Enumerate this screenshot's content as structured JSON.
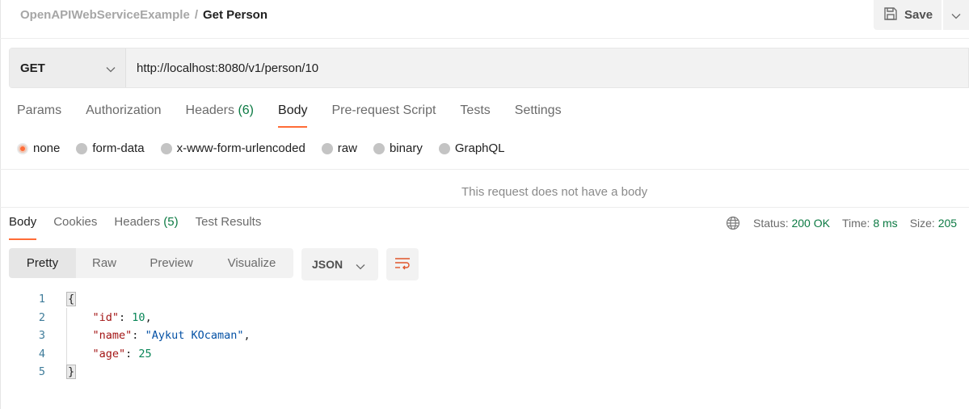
{
  "header": {
    "collection": "OpenAPIWebServiceExample",
    "separator": "/",
    "request_name": "Get Person",
    "save_label": "Save",
    "save_icon": "floppy-disk-icon",
    "more_icon": "chevron-down-icon"
  },
  "request": {
    "method": "GET",
    "url": "http://localhost:8080/v1/person/10",
    "tabs": [
      {
        "label": "Params",
        "count": null
      },
      {
        "label": "Authorization",
        "count": null
      },
      {
        "label": "Headers",
        "count": "(6)"
      },
      {
        "label": "Body",
        "count": null,
        "active": true
      },
      {
        "label": "Pre-request Script",
        "count": null
      },
      {
        "label": "Tests",
        "count": null
      },
      {
        "label": "Settings",
        "count": null
      }
    ],
    "body_types": [
      {
        "label": "none",
        "checked": true
      },
      {
        "label": "form-data",
        "checked": false
      },
      {
        "label": "x-www-form-urlencoded",
        "checked": false
      },
      {
        "label": "raw",
        "checked": false
      },
      {
        "label": "binary",
        "checked": false
      },
      {
        "label": "GraphQL",
        "checked": false
      }
    ],
    "empty_body_message": "This request does not have a body"
  },
  "response": {
    "tabs": [
      {
        "label": "Body",
        "count": null,
        "active": true
      },
      {
        "label": "Cookies",
        "count": null
      },
      {
        "label": "Headers",
        "count": "(5)"
      },
      {
        "label": "Test Results",
        "count": null
      }
    ],
    "status": {
      "label": "Status:",
      "value": "200 OK"
    },
    "time": {
      "label": "Time:",
      "value": "8 ms"
    },
    "size": {
      "label": "Size:",
      "value": "205"
    },
    "view_modes": [
      "Pretty",
      "Raw",
      "Preview",
      "Visualize"
    ],
    "active_view": "Pretty",
    "format": "JSON",
    "wrap_icon": "wrap-lines-icon",
    "globe_icon": "globe-icon",
    "code_lines": [
      {
        "n": "1"
      },
      {
        "n": "2",
        "key": "\"id\"",
        "value": "10",
        "type": "num",
        "trail": ","
      },
      {
        "n": "3",
        "key": "\"name\"",
        "value": "\"Aykut KOcaman\"",
        "type": "str",
        "trail": ","
      },
      {
        "n": "4",
        "key": "\"age\"",
        "value": "25",
        "type": "num",
        "trail": ""
      },
      {
        "n": "5"
      }
    ],
    "open_brace": "{",
    "close_brace": "}"
  },
  "colors": {
    "accent": "#ff6c37",
    "success": "#0c7a43"
  }
}
